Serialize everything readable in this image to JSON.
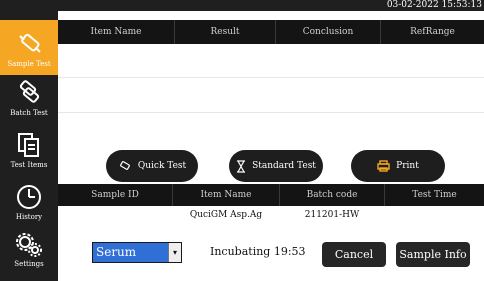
{
  "datetime": "03-02-2022 15:53:13",
  "nav": [
    {
      "label": "Sample Test",
      "icon": "syringe-icon",
      "active": true
    },
    {
      "label": "Batch Test",
      "icon": "batch-icon"
    },
    {
      "label": "Test Items",
      "icon": "documents-icon"
    },
    {
      "label": "History",
      "icon": "clock-icon"
    },
    {
      "label": "Settings",
      "icon": "gears-icon"
    }
  ],
  "result_table": {
    "columns": [
      "Item Name",
      "Result",
      "Conclusion",
      "RefRange"
    ]
  },
  "actions": {
    "quick_test": "Quick Test",
    "standard_test": "Standard Test",
    "print": "Print"
  },
  "sample_table": {
    "columns": [
      "Sample ID",
      "Item Name",
      "Batch code",
      "Test Time"
    ],
    "rows": [
      {
        "sample_id": "",
        "item_name": "QuciGM Asp.Ag",
        "batch_code": "211201-HW",
        "test_time": ""
      }
    ]
  },
  "sample_type": {
    "selected": "Serum"
  },
  "status": "Incubating 19:53",
  "buttons": {
    "cancel": "Cancel",
    "sample_info": "Sample Info"
  },
  "colors": {
    "accent": "#f5a623",
    "select": "#2f6fd6",
    "dark": "#1f1f1f"
  }
}
